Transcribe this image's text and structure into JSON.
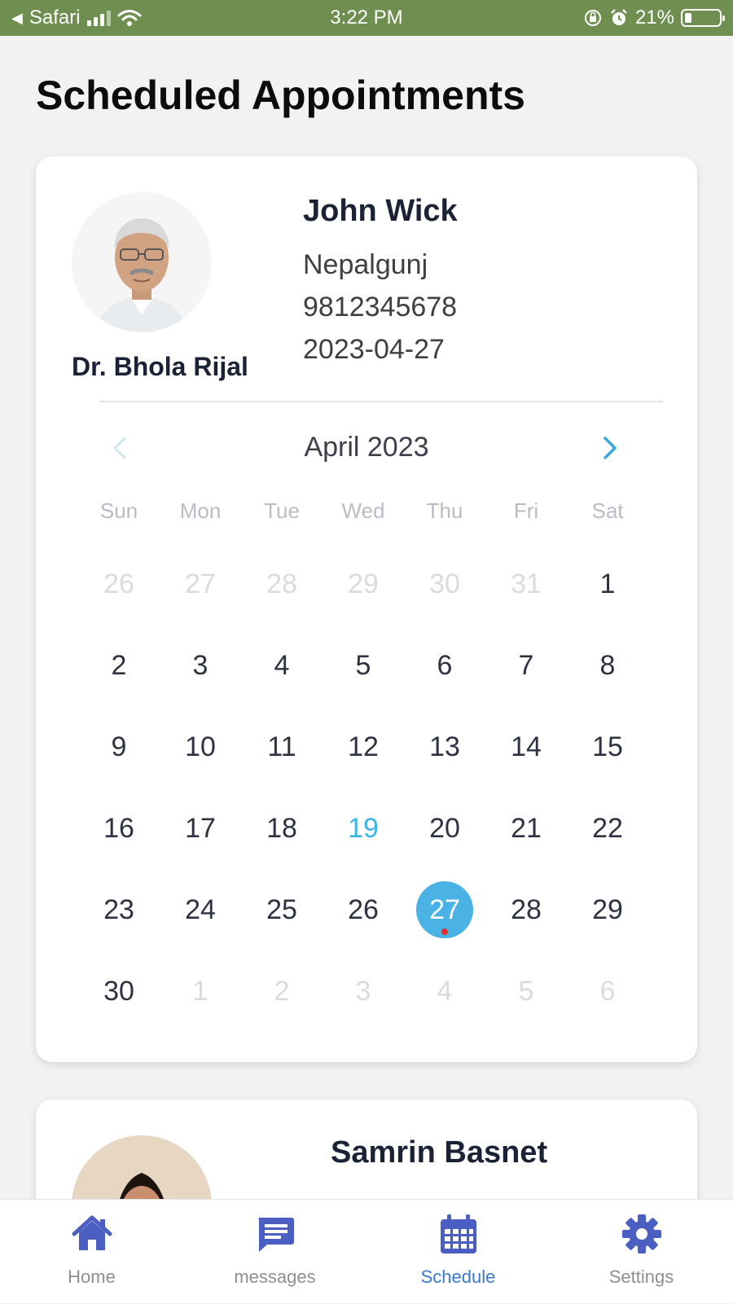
{
  "status_bar": {
    "back_app": "Safari",
    "time": "3:22 PM",
    "battery": "21%"
  },
  "page": {
    "title": "Scheduled Appointments"
  },
  "appointments": [
    {
      "doctor": "Dr. Bhola Rijal",
      "patient": "John Wick",
      "location": "Nepalgunj",
      "phone": "9812345678",
      "date": "2023-04-27",
      "calendar": {
        "month_label": "April 2023",
        "weekdays": [
          "Sun",
          "Mon",
          "Tue",
          "Wed",
          "Thu",
          "Fri",
          "Sat"
        ],
        "weeks": [
          [
            "26",
            "27",
            "28",
            "29",
            "30",
            "31",
            "1"
          ],
          [
            "2",
            "3",
            "4",
            "5",
            "6",
            "7",
            "8"
          ],
          [
            "9",
            "10",
            "11",
            "12",
            "13",
            "14",
            "15"
          ],
          [
            "16",
            "17",
            "18",
            "19",
            "20",
            "21",
            "22"
          ],
          [
            "23",
            "24",
            "25",
            "26",
            "27",
            "28",
            "29"
          ],
          [
            "30",
            "1",
            "2",
            "3",
            "4",
            "5",
            "6"
          ]
        ],
        "today": "19",
        "selected": "27"
      }
    },
    {
      "patient": "Samrin Basnet"
    }
  ],
  "tab_bar": {
    "items": [
      {
        "label": "Home",
        "icon": "home-icon"
      },
      {
        "label": "messages",
        "icon": "message-icon"
      },
      {
        "label": "Schedule",
        "icon": "calendar-icon"
      },
      {
        "label": "Settings",
        "icon": "gear-icon"
      }
    ],
    "active_index": 2,
    "colors": {
      "icon": "#4a5fc1",
      "active_label": "#3a78c7",
      "inactive_label": "#8e8e93"
    }
  },
  "colors": {
    "status_bar": "#6e8f4f",
    "selected_day": "#4bb2e6",
    "today_text": "#3ab4e2",
    "event_dot": "#e0302d"
  }
}
